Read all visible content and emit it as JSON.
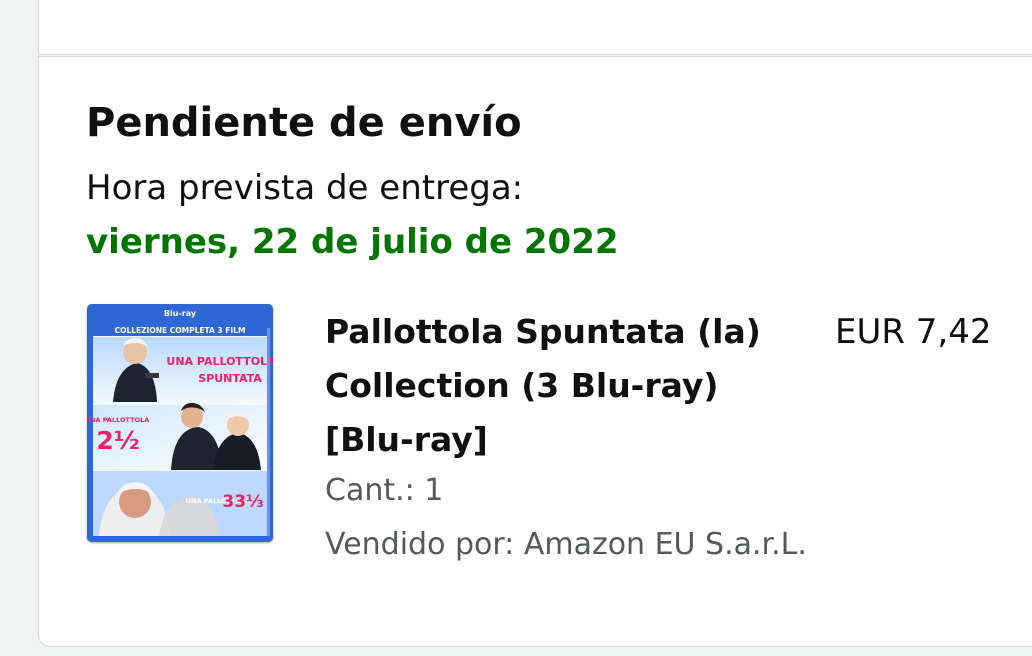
{
  "order": {
    "status_title": "Pendiente de envío",
    "delivery_label": "Hora prevista de entrega:",
    "delivery_date": "viernes, 22 de julio de 2022",
    "colors": {
      "delivery_date": "#007600",
      "text": "#0f1111",
      "secondary_text": "#565959"
    }
  },
  "product": {
    "title_line1": "Pallottola Spuntata (la)",
    "title_line2": "Collection (3 Blu-ray)",
    "title_line3": "[Blu-ray]",
    "price": "EUR 7,42",
    "quantity": "Cant.: 1",
    "sold_by": "Vendido por: Amazon EU S.a.r.L.",
    "image": {
      "icon": "bluray-cover-image",
      "cover_header": "COLLEZIONE COMPLETA 3 FILM",
      "cover_title_1": "UNA PALLOTTOLA",
      "cover_title_2": "SPUNTATA",
      "cover_part_2": "2½",
      "cover_part_3": "33⅓"
    }
  }
}
